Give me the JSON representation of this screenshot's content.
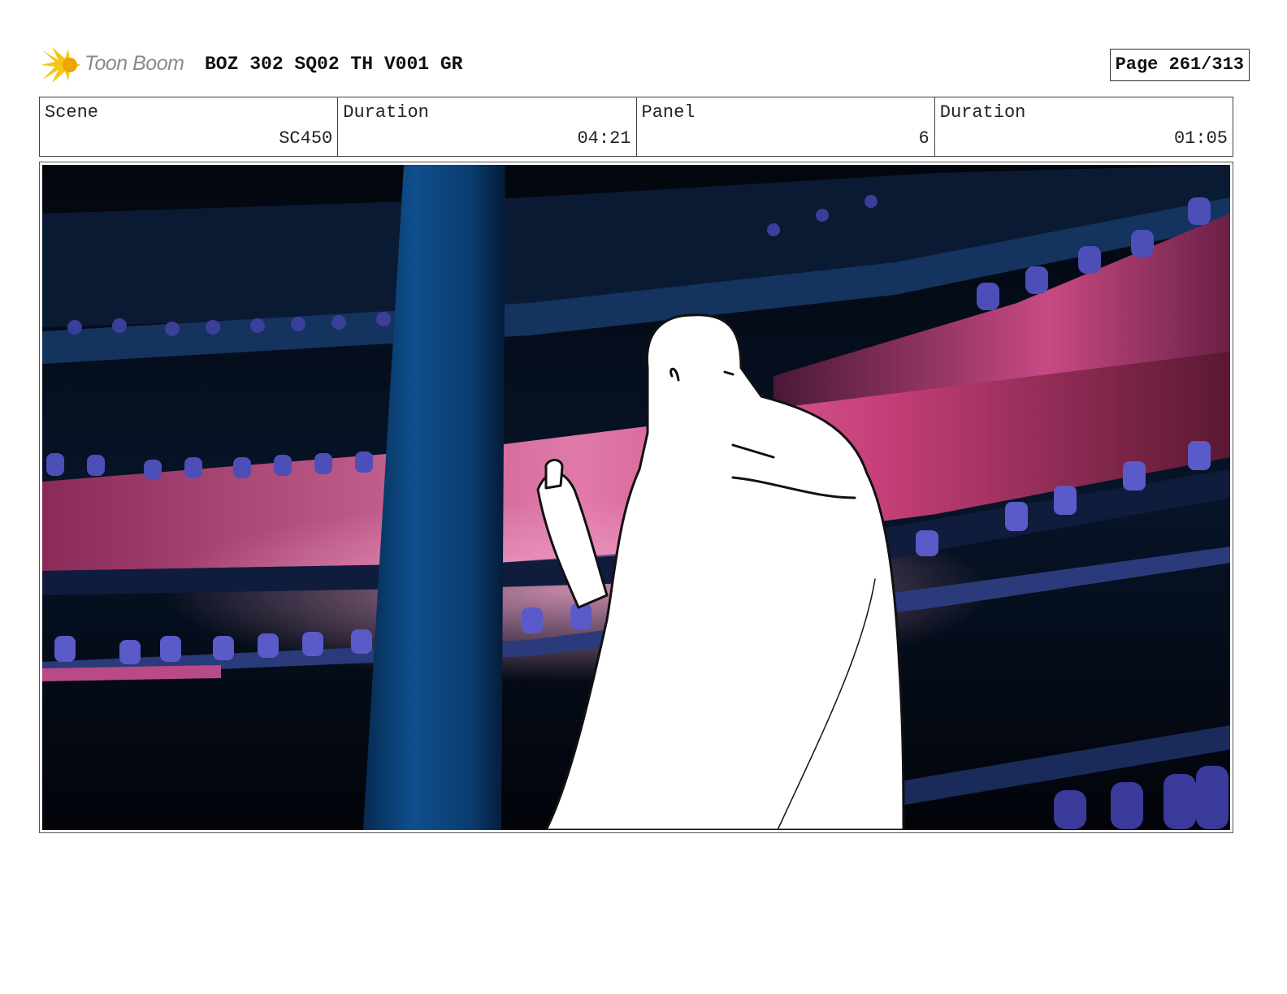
{
  "header": {
    "logo_text": "Toon Boom",
    "title": "BOZ 302 SQ02 TH V001 GR",
    "page": "Page 261/313"
  },
  "info": {
    "scene_label": "Scene",
    "scene_value": "SC450",
    "duration_label": "Duration",
    "duration_value": "04:21",
    "panel_label": "Panel",
    "panel_value": "6",
    "panel_duration_label": "Duration",
    "panel_duration_value": "01:05"
  },
  "colors": {
    "logo_star": "#f5c518",
    "logo_text": "#8a8a8a",
    "scene_background": "#050914",
    "pillar_blue": "#0f4a80",
    "shelf_pink": "#c2467e",
    "bottle_purple": "#5a5ac8"
  },
  "panel": {
    "icons": [
      "toon-boom-star-logo"
    ]
  }
}
